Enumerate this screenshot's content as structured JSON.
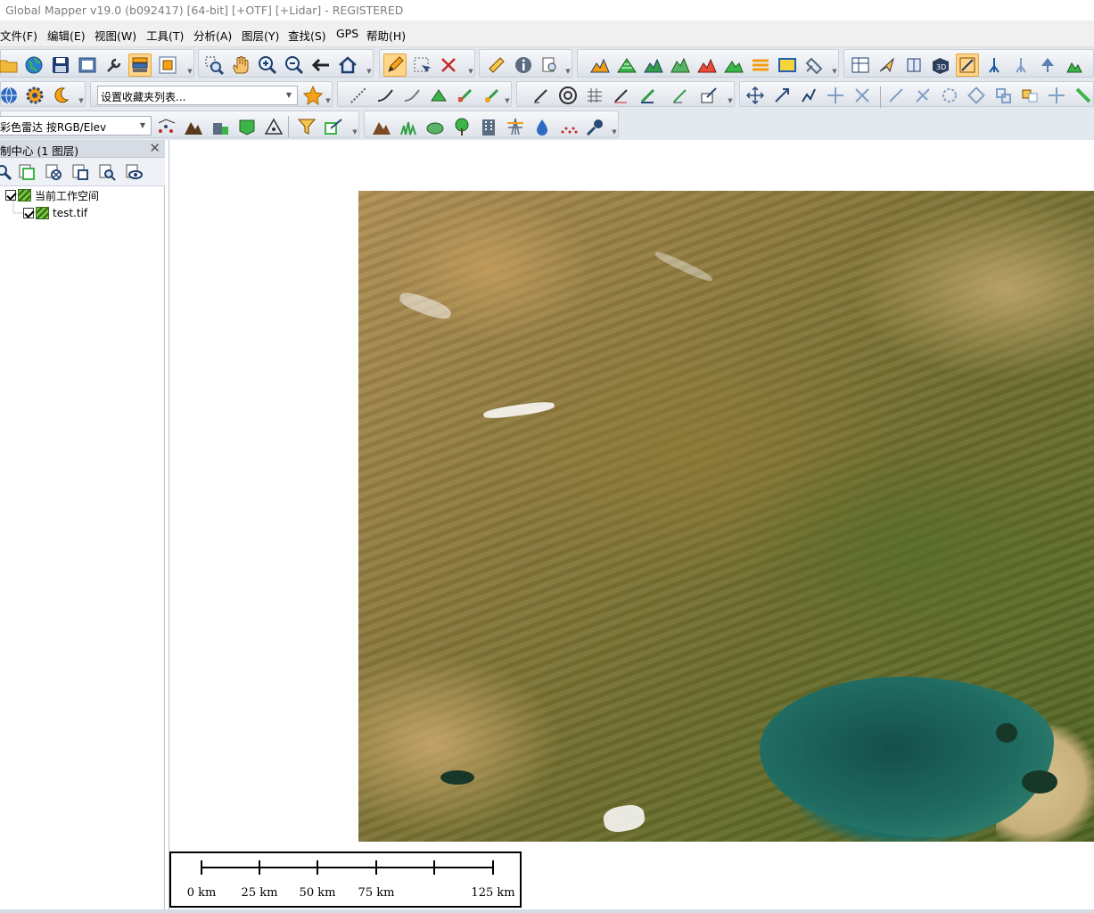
{
  "window": {
    "title": "Global Mapper v19.0 (b092417) [64-bit] [+OTF] [+Lidar] - REGISTERED"
  },
  "menu": [
    {
      "label": "文件(F)"
    },
    {
      "label": "编辑(E)"
    },
    {
      "label": "视图(W)"
    },
    {
      "label": "工具(T)"
    },
    {
      "label": "分析(A)"
    },
    {
      "label": "图层(Y)"
    },
    {
      "label": "查找(S)"
    },
    {
      "label": "GPS"
    },
    {
      "label": "帮助(H)"
    }
  ],
  "toolbar": {
    "favorites_combo": "设置收藏夹列表...",
    "shader_combo": "彩色雷达 按RGB/Elev"
  },
  "control_center": {
    "title": "制中心 (1 图层)",
    "close": "✕",
    "tree": [
      {
        "label": "当前工作空间",
        "checked": true
      },
      {
        "label": "test.tif",
        "checked": true
      }
    ]
  },
  "scale_bar": {
    "labels": [
      "0 km",
      "25 km",
      "50 km",
      "75 km",
      "125 km"
    ]
  },
  "colors": {
    "toolbar_bg": "#e4e8ef",
    "active_button": "#ffd58a",
    "lake": "#1d6d65"
  }
}
